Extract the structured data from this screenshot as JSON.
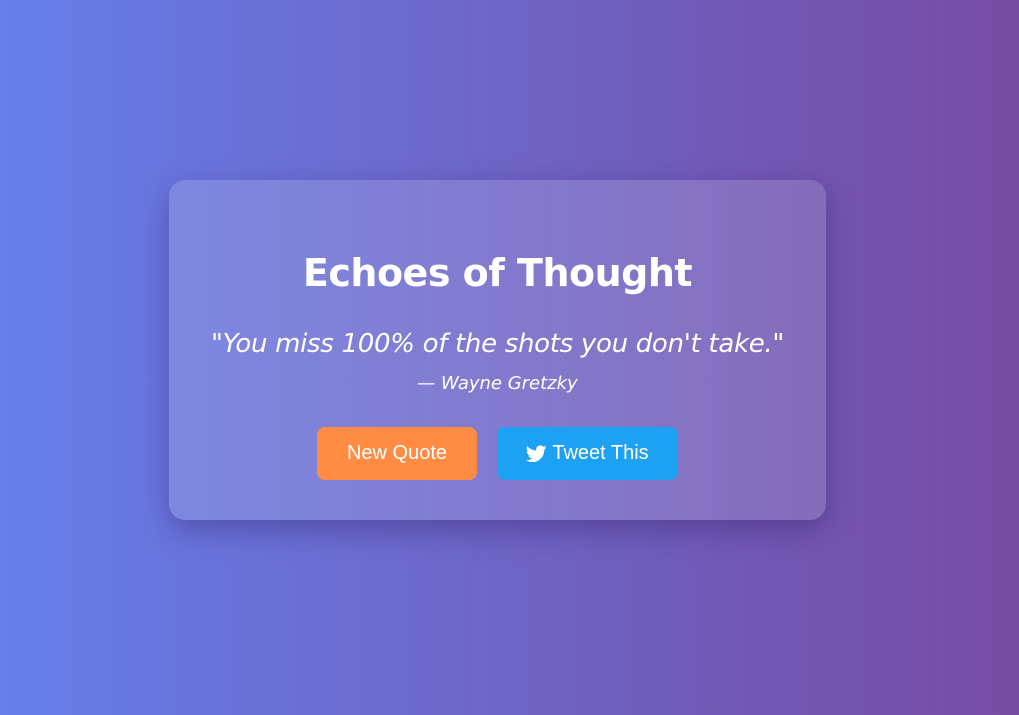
{
  "card": {
    "title": "Echoes of Thought",
    "quote": "\"You miss 100% of the shots you don't take.\"",
    "author": "— Wayne Gretzky"
  },
  "buttons": {
    "new_quote_label": "New Quote",
    "tweet_label": "Tweet This",
    "tweet_icon": "twitter-bird-icon"
  },
  "colors": {
    "background_start": "#667eea",
    "background_end": "#764ba2",
    "new_quote_button": "#ff8c42",
    "tweet_button": "#1da1f2",
    "text": "#ffffff"
  }
}
